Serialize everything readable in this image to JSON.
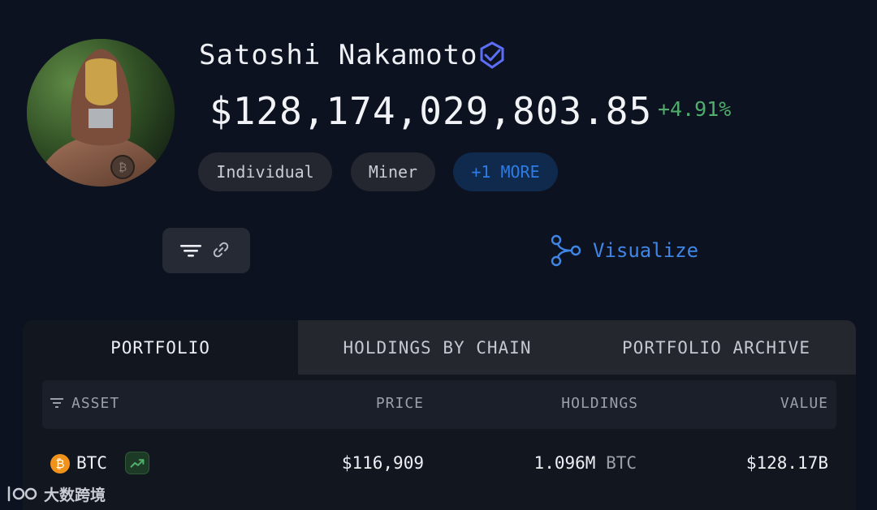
{
  "profile": {
    "name": "Satoshi Nakamoto",
    "verified_icon": "verified-badge-icon",
    "balance": "$128,174,029,803.85",
    "change": "+4.91%",
    "change_color": "#4fae6c",
    "tags": [
      "Individual",
      "Miner"
    ],
    "more_tag": "+1 MORE"
  },
  "toolbar": {
    "filter_icon": "filter-icon",
    "link_icon": "link-icon",
    "visualize_label": "Visualize",
    "visualize_icon": "graph-nodes-icon"
  },
  "tabs": [
    {
      "label": "PORTFOLIO",
      "active": true
    },
    {
      "label": "HOLDINGS BY CHAIN",
      "active": false
    },
    {
      "label": "PORTFOLIO ARCHIVE",
      "active": false
    }
  ],
  "table": {
    "columns": [
      "ASSET",
      "PRICE",
      "HOLDINGS",
      "VALUE"
    ],
    "rows": [
      {
        "asset": "BTC",
        "price": "$116,909",
        "holdings": "1.096M",
        "holdings_unit": "BTC",
        "value": "$128.17B"
      }
    ]
  },
  "watermark": "大数跨境",
  "colors": {
    "accent": "#3f86e6",
    "positive": "#4fae6c",
    "btc": "#f0921b",
    "background": "#0d1220"
  }
}
